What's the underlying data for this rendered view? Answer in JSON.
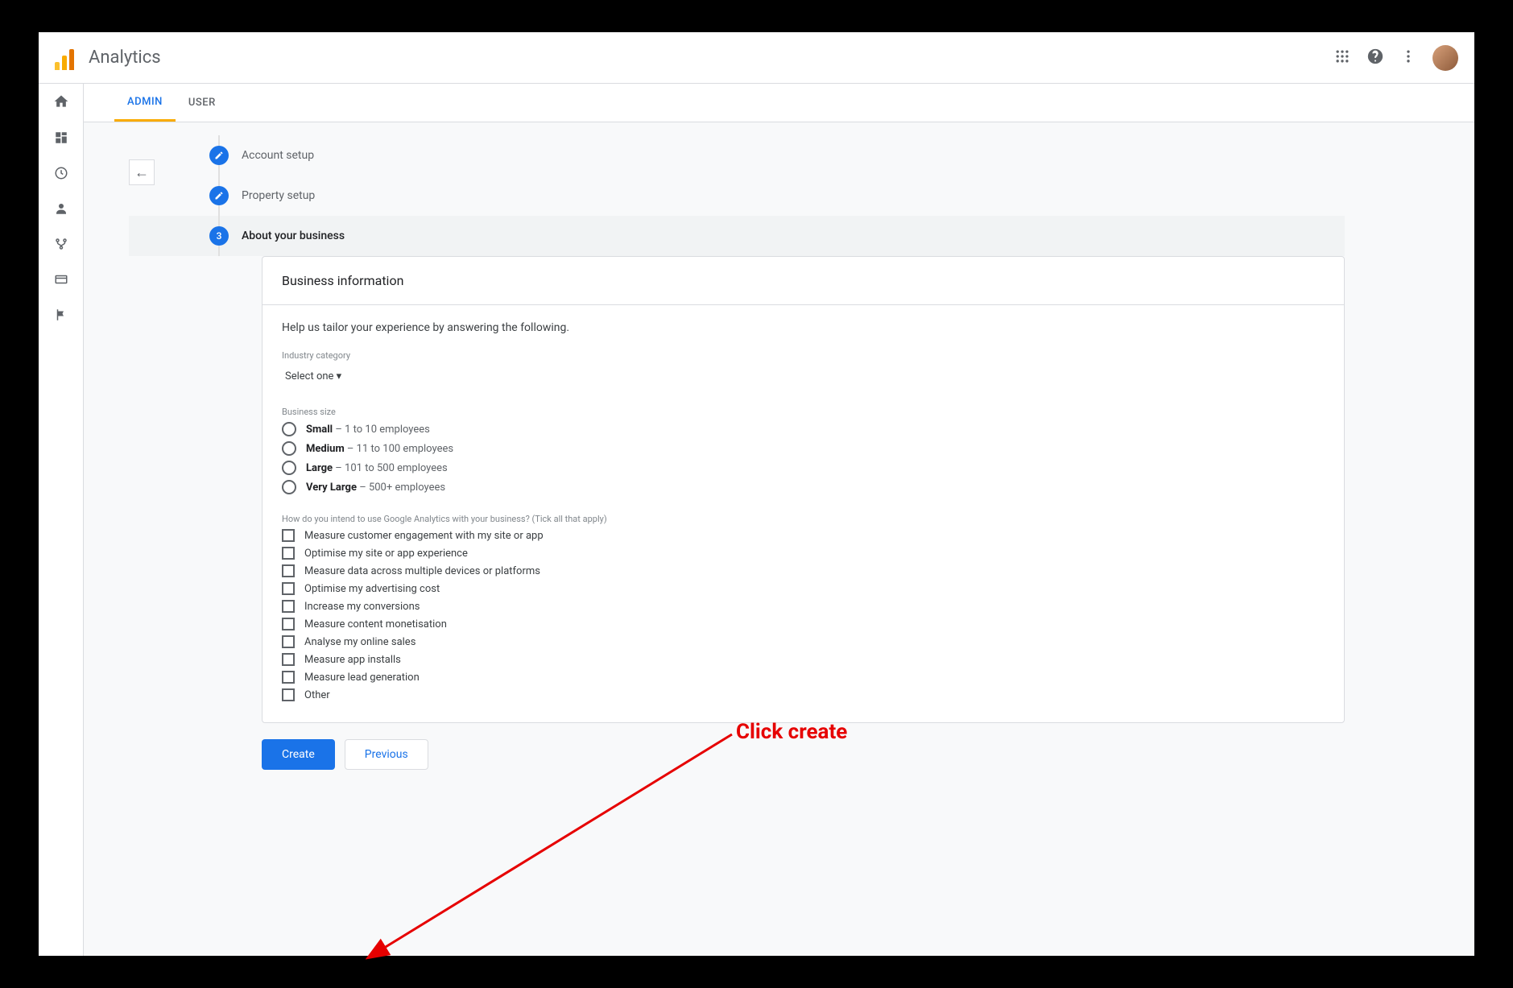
{
  "header": {
    "app_title": "Analytics"
  },
  "tabs": {
    "admin": "ADMIN",
    "user": "USER"
  },
  "steps": {
    "s1": "Account setup",
    "s2": "Property setup",
    "s3_num": "3",
    "s3": "About your business"
  },
  "card": {
    "title": "Business information",
    "help": "Help us tailor your experience by answering the following.",
    "industry_label": "Industry category",
    "industry_select": "Select one ▾",
    "size_label": "Business size",
    "sizes": [
      {
        "name": "Small",
        "detail": " – 1 to 10 employees"
      },
      {
        "name": "Medium",
        "detail": " – 11 to 100 employees"
      },
      {
        "name": "Large",
        "detail": " – 101 to 500 employees"
      },
      {
        "name": "Very Large",
        "detail": " – 500+ employees"
      }
    ],
    "intent_label": "How do you intend to use Google Analytics with your business? (Tick all that apply)",
    "intents": [
      "Measure customer engagement with my site or app",
      "Optimise my site or app experience",
      "Measure data across multiple devices or platforms",
      "Optimise my advertising cost",
      "Increase my conversions",
      "Measure content monetisation",
      "Analyse my online sales",
      "Measure app installs",
      "Measure lead generation",
      "Other"
    ]
  },
  "actions": {
    "create": "Create",
    "previous": "Previous"
  },
  "annotation": {
    "text": "Click create"
  }
}
